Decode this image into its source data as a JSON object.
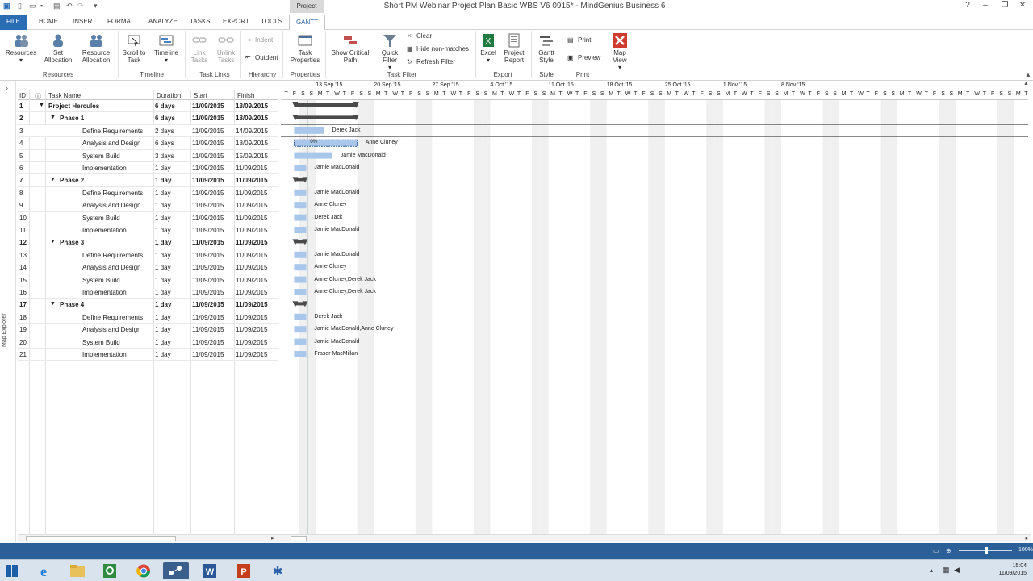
{
  "window": {
    "title": "Short PM Webinar Project Plan Basic WBS V6 0915* - MindGenius Business 6",
    "context_tab": "Project"
  },
  "tabs": [
    "FILE",
    "HOME",
    "INSERT",
    "FORMAT",
    "ANALYZE",
    "TASKS",
    "EXPORT",
    "TOOLS",
    "GANTT"
  ],
  "ribbon": {
    "resources_group": {
      "label": "Resources",
      "buttons": [
        "Resources",
        "Set Allocation",
        "Resource Allocation"
      ]
    },
    "timeline_group": {
      "label": "Timeline",
      "buttons": [
        "Scroll to Task",
        "Timeline"
      ]
    },
    "tasklinks_group": {
      "label": "Task Links",
      "buttons": [
        "Link Tasks",
        "Unlink Tasks"
      ]
    },
    "hierarchy_group": {
      "label": "Hierarchy",
      "buttons": [
        "Indent",
        "Outdent"
      ]
    },
    "properties_group": {
      "label": "Properties",
      "buttons": [
        "Task Properties"
      ]
    },
    "taskfilter_group": {
      "label": "Task Filter",
      "buttons": [
        "Show Critical Path",
        "Quick Filter"
      ],
      "small": [
        "Clear",
        "Hide non-matches",
        "Refresh Filter"
      ]
    },
    "export_group": {
      "label": "Export",
      "buttons": [
        "Excel",
        "Project Report"
      ]
    },
    "style_group": {
      "label": "Style",
      "buttons": [
        "Gantt Style"
      ]
    },
    "print_group": {
      "label": "Print",
      "small": [
        "Print",
        "Preview"
      ]
    },
    "map_group": {
      "buttons": [
        "Map View"
      ]
    }
  },
  "grid": {
    "headers": {
      "id": "ID",
      "name": "Task Name",
      "duration": "Duration",
      "start": "Start",
      "finish": "Finish"
    },
    "rows": [
      {
        "id": "1",
        "name": "Project Hercules",
        "duration": "6 days",
        "start": "11/09/2015",
        "finish": "18/09/2015",
        "level": 0,
        "summary": true
      },
      {
        "id": "2",
        "name": "Phase 1",
        "duration": "6 days",
        "start": "11/09/2015",
        "finish": "18/09/2015",
        "level": 1,
        "summary": true
      },
      {
        "id": "3",
        "name": "Define Requirements",
        "duration": "2 days",
        "start": "11/09/2015",
        "finish": "14/09/2015",
        "level": 2,
        "summary": false
      },
      {
        "id": "4",
        "name": "Analysis and Design",
        "duration": "6 days",
        "start": "11/09/2015",
        "finish": "18/09/2015",
        "level": 2,
        "summary": false
      },
      {
        "id": "5",
        "name": "System Build",
        "duration": "3 days",
        "start": "11/09/2015",
        "finish": "15/09/2015",
        "level": 2,
        "summary": false
      },
      {
        "id": "6",
        "name": "Implementation",
        "duration": "1 day",
        "start": "11/09/2015",
        "finish": "11/09/2015",
        "level": 2,
        "summary": false
      },
      {
        "id": "7",
        "name": "Phase 2",
        "duration": "1 day",
        "start": "11/09/2015",
        "finish": "11/09/2015",
        "level": 1,
        "summary": true
      },
      {
        "id": "8",
        "name": "Define Requirements",
        "duration": "1 day",
        "start": "11/09/2015",
        "finish": "11/09/2015",
        "level": 2,
        "summary": false
      },
      {
        "id": "9",
        "name": "Analysis and Design",
        "duration": "1 day",
        "start": "11/09/2015",
        "finish": "11/09/2015",
        "level": 2,
        "summary": false
      },
      {
        "id": "10",
        "name": "System Build",
        "duration": "1 day",
        "start": "11/09/2015",
        "finish": "11/09/2015",
        "level": 2,
        "summary": false
      },
      {
        "id": "11",
        "name": "Implementation",
        "duration": "1 day",
        "start": "11/09/2015",
        "finish": "11/09/2015",
        "level": 2,
        "summary": false
      },
      {
        "id": "12",
        "name": "Phase 3",
        "duration": "1 day",
        "start": "11/09/2015",
        "finish": "11/09/2015",
        "level": 1,
        "summary": true
      },
      {
        "id": "13",
        "name": "Define Requirements",
        "duration": "1 day",
        "start": "11/09/2015",
        "finish": "11/09/2015",
        "level": 2,
        "summary": false
      },
      {
        "id": "14",
        "name": "Analysis and Design",
        "duration": "1 day",
        "start": "11/09/2015",
        "finish": "11/09/2015",
        "level": 2,
        "summary": false
      },
      {
        "id": "15",
        "name": "System Build",
        "duration": "1 day",
        "start": "11/09/2015",
        "finish": "11/09/2015",
        "level": 2,
        "summary": false
      },
      {
        "id": "16",
        "name": "Implementation",
        "duration": "1 day",
        "start": "11/09/2015",
        "finish": "11/09/2015",
        "level": 2,
        "summary": false
      },
      {
        "id": "17",
        "name": "Phase 4",
        "duration": "1 day",
        "start": "11/09/2015",
        "finish": "11/09/2015",
        "level": 1,
        "summary": true
      },
      {
        "id": "18",
        "name": "Define Requirements",
        "duration": "1 day",
        "start": "11/09/2015",
        "finish": "11/09/2015",
        "level": 2,
        "summary": false
      },
      {
        "id": "19",
        "name": "Analysis and Design",
        "duration": "1 day",
        "start": "11/09/2015",
        "finish": "11/09/2015",
        "level": 2,
        "summary": false
      },
      {
        "id": "20",
        "name": "System Build",
        "duration": "1 day",
        "start": "11/09/2015",
        "finish": "11/09/2015",
        "level": 2,
        "summary": false
      },
      {
        "id": "21",
        "name": "Implementation",
        "duration": "1 day",
        "start": "11/09/2015",
        "finish": "11/09/2015",
        "level": 2,
        "summary": false
      }
    ]
  },
  "gantt": {
    "weeks": [
      "13 Sep '15",
      "20 Sep '15",
      "27 Sep '15",
      "4 Oct '15",
      "11 Oct '15",
      "18 Oct '15",
      "25 Oct '15",
      "1 Nov '15",
      "8 Nov '15"
    ],
    "day_letters": [
      "T",
      "F",
      "S",
      "S",
      "M",
      "T",
      "W",
      "T",
      "F",
      "S",
      "S",
      "M",
      "T",
      "W",
      "T",
      "F",
      "S",
      "S",
      "M",
      "T",
      "W",
      "T",
      "F",
      "S",
      "S",
      "M",
      "T",
      "W",
      "T",
      "F",
      "S",
      "S",
      "M",
      "T",
      "W",
      "T",
      "F",
      "S",
      "S",
      "M",
      "T",
      "W",
      "T",
      "F",
      "S",
      "S",
      "M",
      "T",
      "W",
      "T",
      "F",
      "S",
      "S",
      "M",
      "T",
      "W",
      "T",
      "F",
      "S",
      "S",
      "M",
      "T",
      "W",
      "T",
      "F",
      "S",
      "S",
      "M",
      "T",
      "W",
      "T",
      "F",
      "S",
      "S",
      "M",
      "T",
      "W",
      "T",
      "F",
      "S",
      "S",
      "M",
      "T",
      "W",
      "T",
      "F",
      "S",
      "S",
      "M",
      "T",
      "W",
      "T",
      "F",
      "S",
      "S",
      "M",
      "T",
      "W",
      "T",
      "F",
      "S",
      "S",
      "M",
      "T",
      "W",
      "T",
      "F",
      "S",
      "S",
      "M",
      "T",
      "W",
      "T",
      "F",
      "S",
      "S",
      "M",
      "T",
      "W",
      "T",
      "F",
      "S",
      "S",
      "M",
      "T",
      "W",
      "T"
    ],
    "resources": [
      "",
      "",
      "Derek Jack",
      "Anne Cluney",
      "Jamie MacDonald",
      "Jamie MacDonald",
      "",
      "Jamie MacDonald",
      "Anne Cluney",
      "Derek Jack",
      "Jamie MacDonald",
      "",
      "Jamie MacDonald",
      "Anne Cluney",
      "Anne Cluney,Derek Jack",
      "Anne Cluney,Derek Jack",
      "",
      "Derek Jack",
      "Jamie MacDonald,Anne Cluney",
      "Jamie MacDonald",
      "Fraser MacMillan"
    ],
    "bar_days": [
      6,
      6,
      2,
      6,
      3,
      1,
      1,
      1,
      1,
      1,
      1,
      1,
      1,
      1,
      1,
      1,
      1,
      1,
      1,
      1,
      1
    ],
    "selected_bar_label": "0%"
  },
  "sidebar": {
    "map_explorer": "Map Explorer"
  },
  "status": {
    "zoom": "100%"
  },
  "clock": {
    "time": "15:04",
    "date": "11/09/2015"
  }
}
